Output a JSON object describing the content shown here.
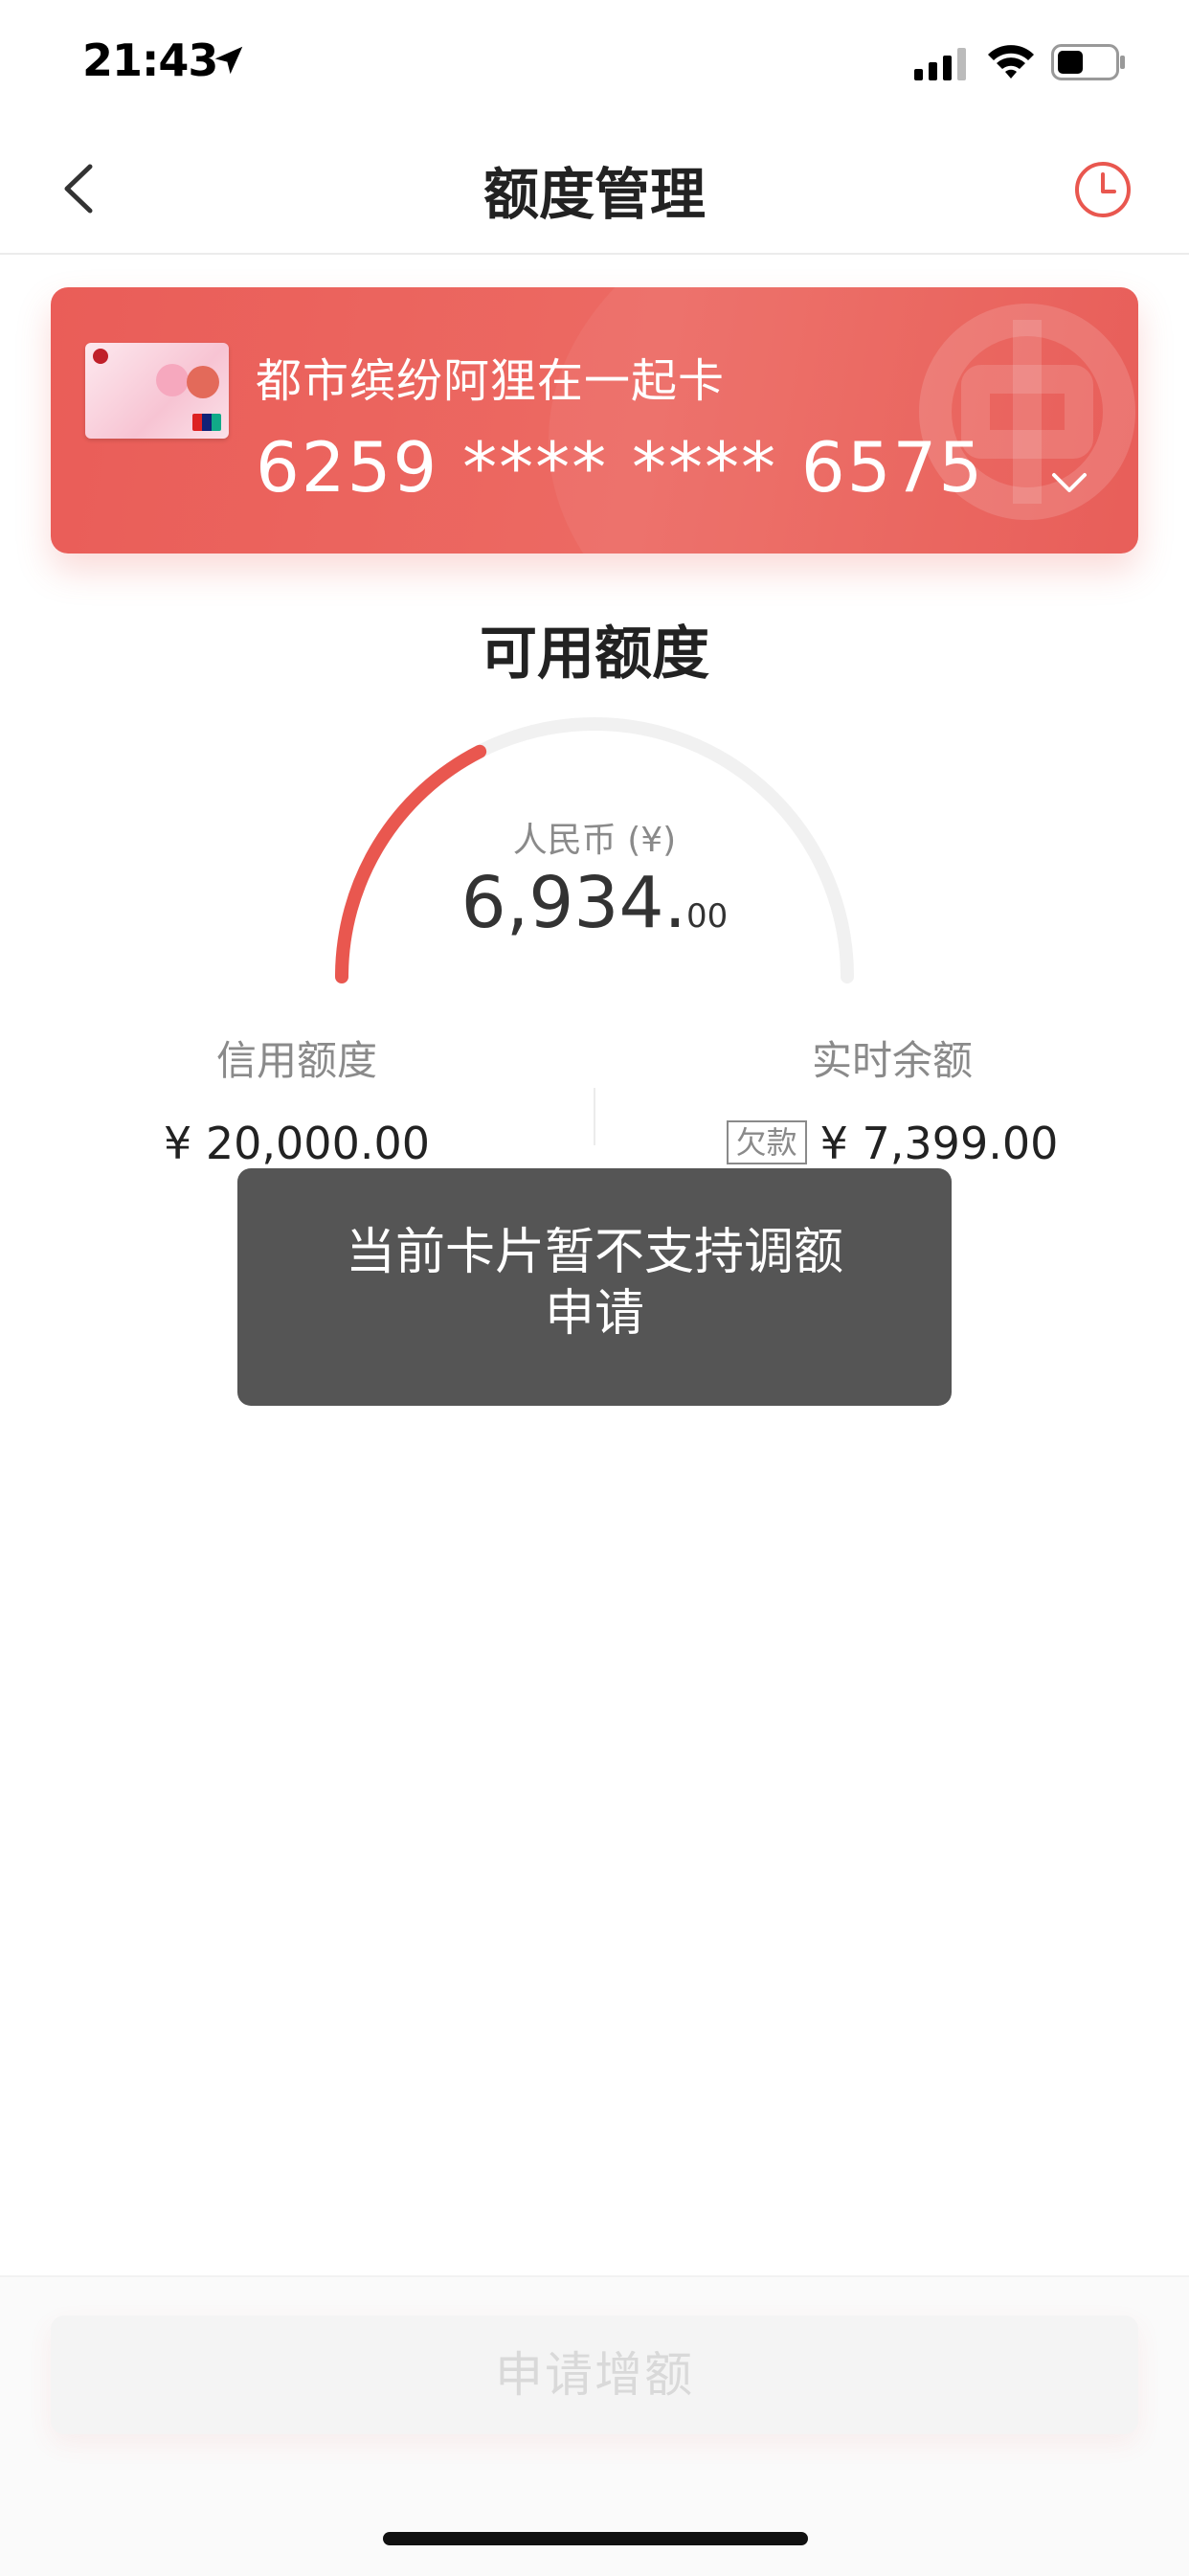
{
  "status_bar": {
    "time": "21:43"
  },
  "nav": {
    "title": "额度管理",
    "back_icon": "chevron-left-icon",
    "history_icon": "clock-icon"
  },
  "card": {
    "name": "都市缤纷阿狸在一起卡",
    "number": "6259 **** **** 6575",
    "chevron_icon": "chevron-down-icon"
  },
  "available": {
    "title": "可用额度",
    "currency_label": "人民币 (¥)",
    "amount_int": "6,934.",
    "amount_dec": "00",
    "used_fraction": 0.35
  },
  "limits": {
    "credit_label": "信用额度",
    "credit_value": "¥ 20,000.00",
    "balance_label": "实时余额",
    "balance_tag": "欠款",
    "balance_value": "¥ 7,399.00"
  },
  "toast": {
    "line1": "当前卡片暂不支持调额",
    "line2": "申请"
  },
  "bottom": {
    "apply_label": "申请增额"
  },
  "colors": {
    "accent": "#e9574f",
    "gauge_track": "#f1f1f1"
  }
}
